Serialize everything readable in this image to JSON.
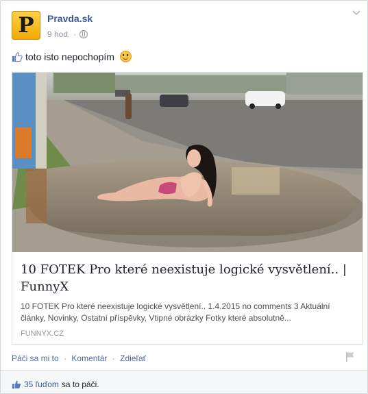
{
  "post": {
    "page_name": "Pravda.sk",
    "avatar_letter": "P",
    "time": "9 hod.",
    "separator": "·",
    "status_text": "toto isto nepochopím"
  },
  "link": {
    "title": "10 FOTEK Pro které neexistuje logické vysvětlení.. | FunnyX",
    "description": "10 FOTEK Pro které neexistuje logické vysvětlení.. 1.4.2015 no comments 3 Aktuální články, Novinky, Ostatní příspěvky, Vtipné obrázky Fotky které absolutně...",
    "domain": "FUNNYX.CZ"
  },
  "actions": {
    "like": "Páči sa mi to",
    "comment": "Komentár",
    "share": "Zdieľať",
    "dot": "·"
  },
  "likes": {
    "count": "35 ľuďom",
    "suffix": "sa to páči."
  },
  "colors": {
    "link_blue": "#3b5998",
    "avatar_yellow": "#f6b800",
    "text": "#1d2129",
    "meta": "#90949c"
  },
  "icons": [
    "globe-icon",
    "chevron-down-icon",
    "thumbs-up-icon",
    "smiley-icon",
    "flag-icon"
  ]
}
